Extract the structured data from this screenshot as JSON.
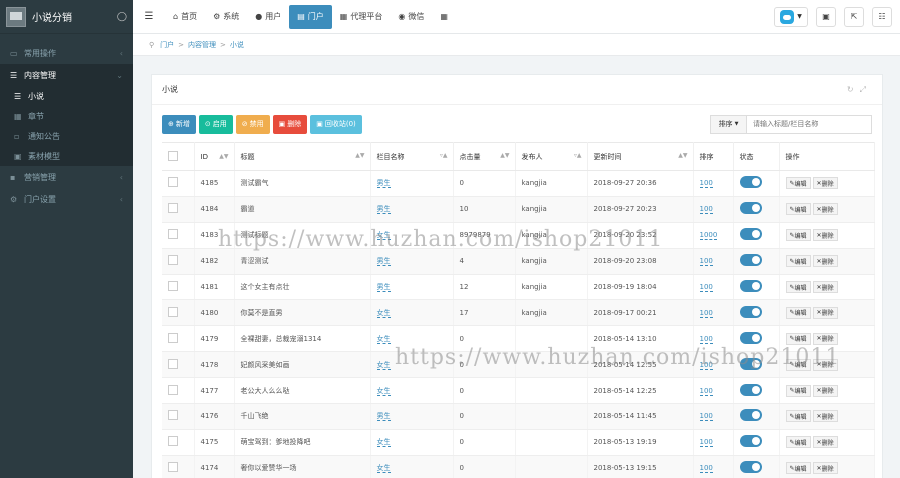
{
  "app": {
    "title": "小说分销"
  },
  "sidebar": {
    "items": [
      {
        "label": "常用操作"
      },
      {
        "label": "内容管理"
      },
      {
        "label": "营销管理"
      },
      {
        "label": "门户设置"
      }
    ],
    "sub_items": [
      {
        "label": "小说"
      },
      {
        "label": "章节"
      },
      {
        "label": "通知公告"
      },
      {
        "label": "素材模型"
      }
    ]
  },
  "topnav": {
    "items": [
      {
        "label": "首页"
      },
      {
        "label": "系统"
      },
      {
        "label": "用户"
      },
      {
        "label": "门户"
      },
      {
        "label": "代理平台"
      },
      {
        "label": "微信"
      }
    ]
  },
  "breadcrumb": {
    "items": [
      "门户",
      "内容管理",
      "小说"
    ]
  },
  "panel": {
    "title": "小说"
  },
  "toolbar": {
    "add": "新增",
    "enable": "启用",
    "disable": "禁用",
    "delete": "删除",
    "recycle": "回收站(0)",
    "sort_label": "排序",
    "search_placeholder": "请输入标题/栏目名称"
  },
  "table": {
    "columns": [
      "ID",
      "标题",
      "栏目名称",
      "点击量",
      "发布人",
      "更新时间",
      "排序",
      "状态",
      "操作"
    ],
    "edit_label": "编辑",
    "delete_label": "删除",
    "rows": [
      {
        "id": "4185",
        "title": "测试霸气",
        "column": "男生",
        "clicks": "0",
        "author": "kangjia",
        "updated": "2018-09-27 20:36",
        "sort": "100"
      },
      {
        "id": "4184",
        "title": "霸道",
        "column": "男生",
        "clicks": "10",
        "author": "kangjia",
        "updated": "2018-09-27 20:23",
        "sort": "100"
      },
      {
        "id": "4183",
        "title": "测试标题",
        "column": "女生",
        "clicks": "8979879",
        "author": "kangjia",
        "updated": "2018-09-20 23:52",
        "sort": "1000"
      },
      {
        "id": "4182",
        "title": "青涩测试",
        "column": "男生",
        "clicks": "4",
        "author": "kangjia",
        "updated": "2018-09-20 23:08",
        "sort": "100"
      },
      {
        "id": "4181",
        "title": "这个女主有点壮",
        "column": "男生",
        "clicks": "12",
        "author": "kangjia",
        "updated": "2018-09-19 18:04",
        "sort": "100"
      },
      {
        "id": "4180",
        "title": "你莫不是直男",
        "column": "女生",
        "clicks": "17",
        "author": "kangjia",
        "updated": "2018-09-17 00:21",
        "sort": "100"
      },
      {
        "id": "4179",
        "title": "全裸甜妻，总裁宠溺1314",
        "column": "女生",
        "clicks": "0",
        "author": "",
        "updated": "2018-05-14 13:10",
        "sort": "100"
      },
      {
        "id": "4178",
        "title": "妃颜风采美如画",
        "column": "女生",
        "clicks": "0",
        "author": "",
        "updated": "2018-05-14 12:55",
        "sort": "100"
      },
      {
        "id": "4177",
        "title": "老公大人么么哒",
        "column": "女生",
        "clicks": "0",
        "author": "",
        "updated": "2018-05-14 12:25",
        "sort": "100"
      },
      {
        "id": "4176",
        "title": "千山飞绝",
        "column": "男生",
        "clicks": "0",
        "author": "",
        "updated": "2018-05-14 11:45",
        "sort": "100"
      },
      {
        "id": "4175",
        "title": "萌宝驾到：爹地投降吧",
        "column": "女生",
        "clicks": "0",
        "author": "",
        "updated": "2018-05-13 19:19",
        "sort": "100"
      },
      {
        "id": "4174",
        "title": "奢你以爱赞华一场",
        "column": "女生",
        "clicks": "0",
        "author": "",
        "updated": "2018-05-13 19:15",
        "sort": "100"
      }
    ]
  },
  "watermark": {
    "text": "https://www.huzhan.com/ishop21011"
  },
  "colors": {
    "sidebar": "#2c3b41",
    "accent": "#3c8dbc"
  }
}
